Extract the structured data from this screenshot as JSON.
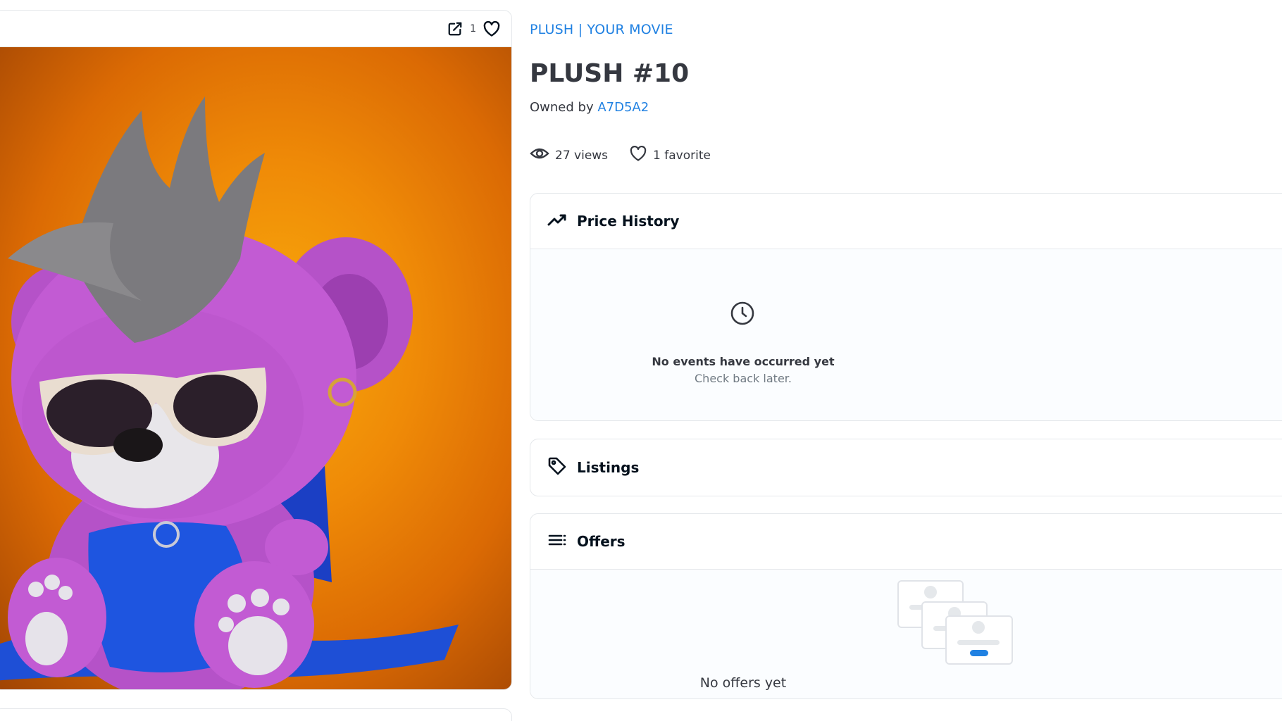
{
  "image_card": {
    "favorite_count": "1",
    "icons": {
      "open": "external-link-icon",
      "favorite": "heart-icon"
    },
    "background_colors": [
      "#f8a90b",
      "#db6a04",
      "#9e4304"
    ]
  },
  "item": {
    "collection": "PLUSH | YOUR MOVIE",
    "title": "PLUSH #10",
    "owner_prefix": "Owned by",
    "owner": "A7D5A2",
    "views": "27 views",
    "favorites": "1 favorite"
  },
  "price_history": {
    "title": "Price History",
    "empty_title": "No events have occurred yet",
    "empty_subtitle": "Check back later."
  },
  "listings": {
    "title": "Listings"
  },
  "offers": {
    "title": "Offers",
    "empty_text": "No offers yet"
  },
  "colors": {
    "link": "#2081e2",
    "text": "#353840",
    "border": "#e5e8eb"
  }
}
